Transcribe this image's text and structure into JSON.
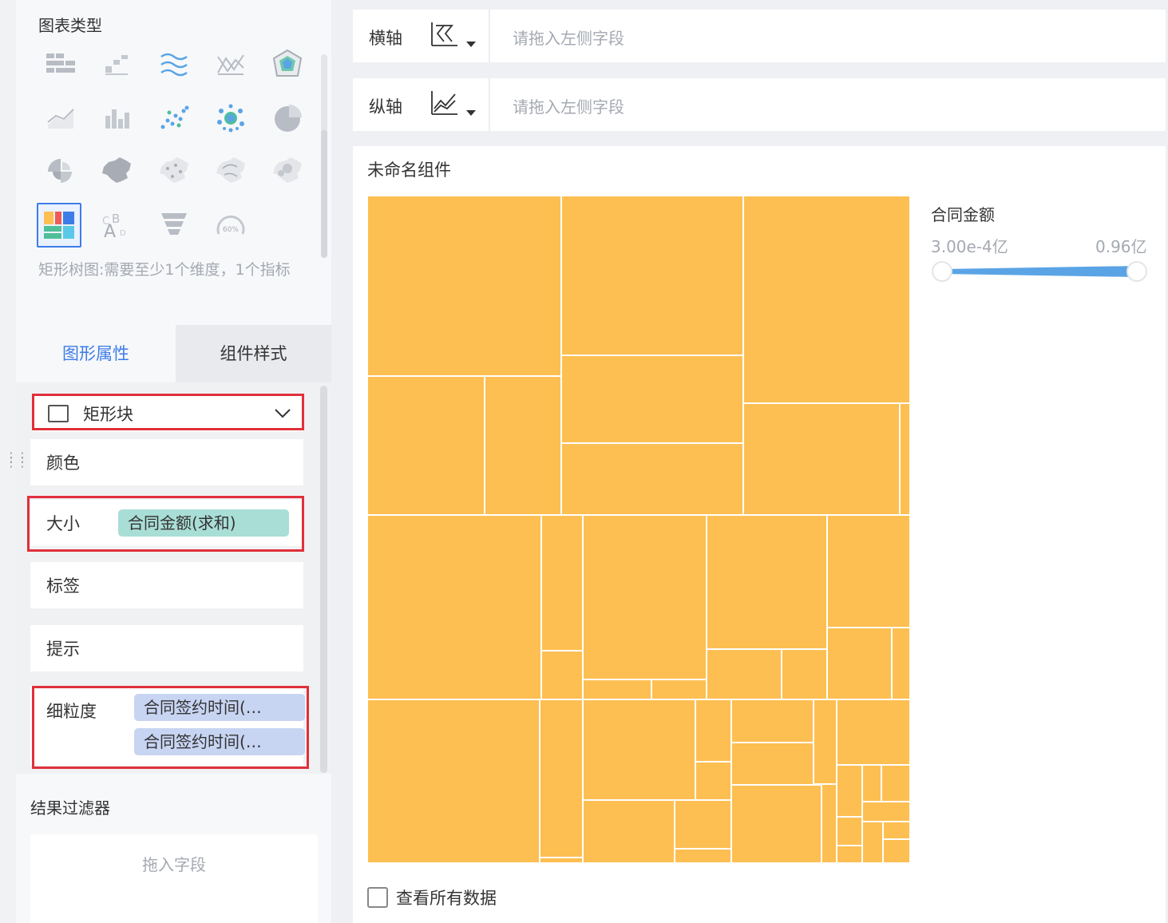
{
  "chart_types": {
    "title": "图表类型",
    "hint": "矩形树图:需要至少1个维度，1个指标",
    "gauge_label": "60%",
    "items": [
      {
        "icon": "grouped-table-icon"
      },
      {
        "icon": "cross-table-icon"
      },
      {
        "icon": "multi-line-icon"
      },
      {
        "icon": "crossing-line-icon"
      },
      {
        "icon": "radar-icon"
      },
      {
        "icon": "area-line-icon"
      },
      {
        "icon": "bar-chart-icon"
      },
      {
        "icon": "scatter-icon"
      },
      {
        "icon": "bubble-icon"
      },
      {
        "icon": "pie-icon"
      },
      {
        "icon": "rose-pie-icon"
      },
      {
        "icon": "china-map-icon"
      },
      {
        "icon": "point-map-icon"
      },
      {
        "icon": "flow-map-icon"
      },
      {
        "icon": "heat-map-icon"
      },
      {
        "icon": "treemap-icon",
        "selected": true
      },
      {
        "icon": "word-cloud-icon"
      },
      {
        "icon": "funnel-icon"
      },
      {
        "icon": "gauge-icon"
      }
    ]
  },
  "tabs": {
    "graphic_props": "图形属性",
    "component_style": "组件样式"
  },
  "props": {
    "shape": "矩形块",
    "color": "颜色",
    "size": "大小",
    "size_field": "合同金额(求和)",
    "label": "标签",
    "tooltip": "提示",
    "granularity": "细粒度",
    "granularity_fields": [
      "合同签约时间(…",
      "合同签约时间(…"
    ]
  },
  "filter": {
    "title": "结果过滤器",
    "drop_hint": "拖入字段"
  },
  "axes": {
    "x_label": "横轴",
    "y_label": "纵轴",
    "placeholder": "请拖入左侧字段"
  },
  "component": {
    "title": "未命名组件",
    "legend_title": "合同金额",
    "legend_min": "3.00e-4亿",
    "legend_max": "0.96亿",
    "legend_color": "#5aa4e6",
    "fill_color": "#fdbf52",
    "view_all": "查看所有数据"
  }
}
